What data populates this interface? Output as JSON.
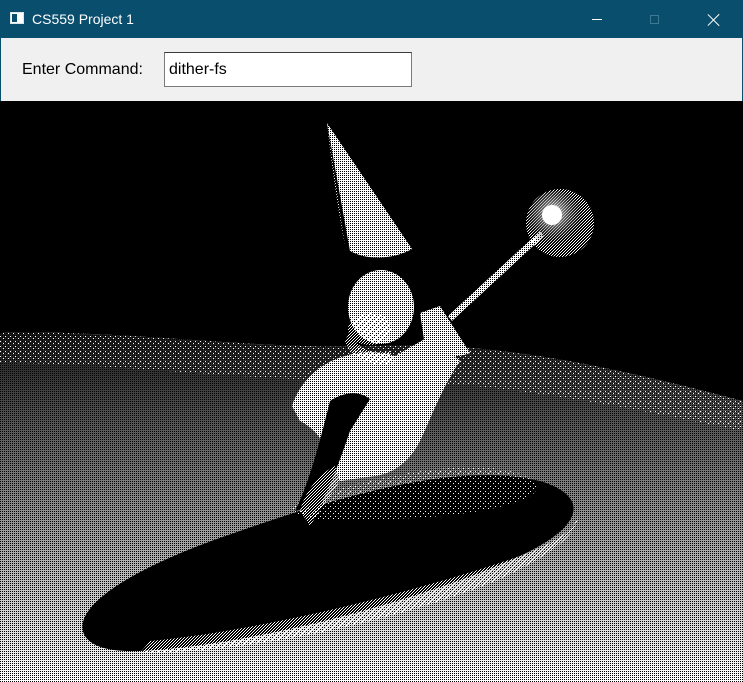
{
  "window": {
    "title": "CS559 Project 1",
    "icon": "app-window-icon",
    "controls": [
      "minimize-icon",
      "maximize-icon",
      "close-icon"
    ]
  },
  "toolbar": {
    "command_label": "Enter Command:",
    "command_value": "dither-fs"
  },
  "canvas": {
    "description_icon": "dithered-render-image",
    "colors": {
      "background": "#000000",
      "foreground": "#ffffff",
      "titlebar": "#0a4e6e"
    }
  }
}
